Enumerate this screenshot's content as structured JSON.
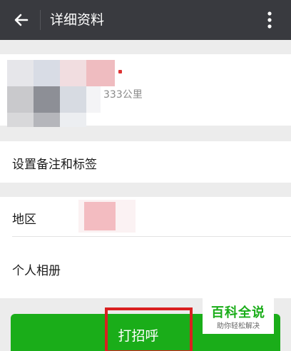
{
  "header": {
    "title": "详细资料",
    "back_icon": "arrow-left-icon",
    "more_icon": "more-vertical-icon"
  },
  "profile": {
    "distance_text": "333公里"
  },
  "rows": {
    "tags_label": "设置备注和标签",
    "region_label": "地区",
    "album_label": "个人相册"
  },
  "actions": {
    "greet_label": "打招呼"
  },
  "watermark": {
    "title": "百科全说",
    "subtitle": "助你轻松解决"
  },
  "colors": {
    "topbar": "#393a3f",
    "primary_button": "#1aad19",
    "highlight": "#d92020",
    "background": "#ececec"
  }
}
